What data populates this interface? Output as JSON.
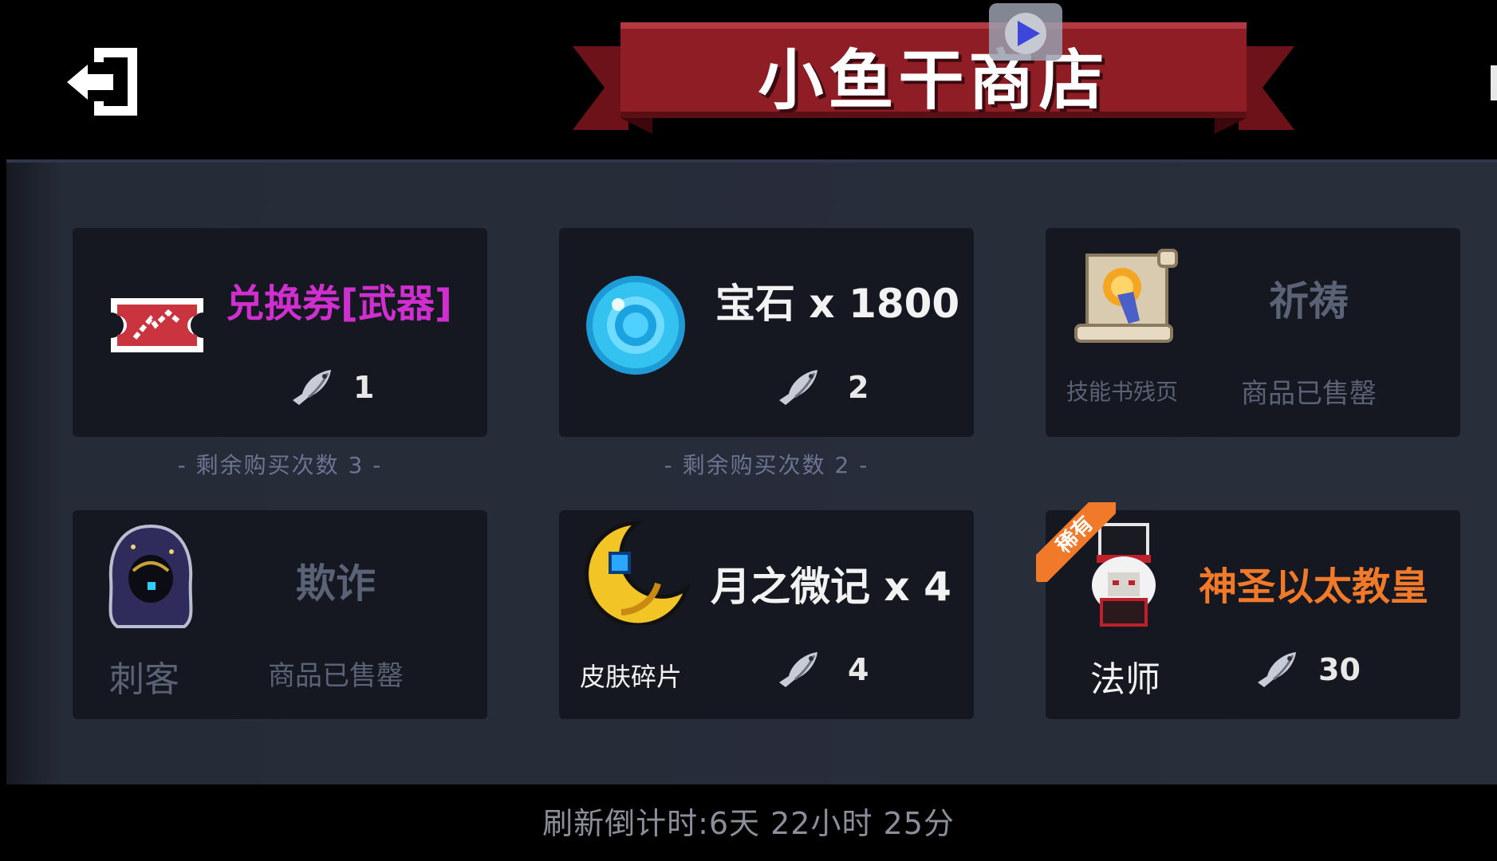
{
  "header": {
    "title": "小鱼干商店",
    "exit_icon": "exit-door-icon",
    "video_icon": "video-play-icon"
  },
  "colors": {
    "banner_red": "#8e1d26",
    "rare_orange": "#f07a2a",
    "title_purple": "#cf2fcf",
    "soldout_gray": "#5a6276",
    "card_bg": "#151820"
  },
  "items": [
    {
      "title": "兑换券[武器]",
      "icon": "weapon-ticket-icon",
      "currency_icon": "dried-fish-icon",
      "price": "1",
      "remaining": "- 剩余购买次数 3 -"
    },
    {
      "title": "宝石 x 1800",
      "icon": "blue-gem-icon",
      "currency_icon": "dried-fish-icon",
      "price": "2",
      "remaining": "- 剩余购买次数 2 -"
    },
    {
      "title": "祈祷",
      "icon": "skill-book-scroll-icon",
      "subtitle": "技能书残页",
      "status": "商品已售罄"
    },
    {
      "title": "欺诈",
      "icon": "assassin-hood-icon",
      "subtitle": "刺客",
      "status": "商品已售罄"
    },
    {
      "title": "月之微记 x 4",
      "icon": "crescent-moon-icon",
      "subtitle": "皮肤碎片",
      "currency_icon": "dried-fish-icon",
      "price": "4"
    },
    {
      "title": "神圣以太教皇",
      "icon": "holy-pope-mage-icon",
      "badge": "稀有",
      "subtitle": "法师",
      "currency_icon": "dried-fish-icon",
      "price": "30"
    }
  ],
  "footer": {
    "refresh_text": "刷新倒计时:6天 22小时 25分"
  }
}
